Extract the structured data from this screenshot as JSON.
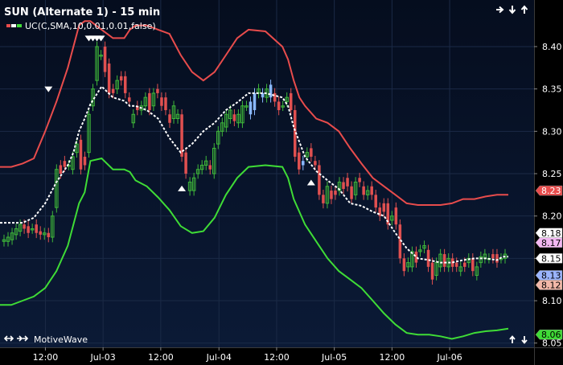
{
  "title": "SUN (Alternate 1) - 15 min",
  "brand": "MotiveWave",
  "colors": {
    "bg_top": "#050d1e",
    "bg_bottom": "#0b1a36",
    "grid": "#1b2a46",
    "upper_band": "#e84c4c",
    "lower_band": "#3fdc36",
    "sma": "#ffffff",
    "candle_up": "#3fb83a",
    "candle_down": "#e05050",
    "candle_blue": "#8ab8ff"
  },
  "chart_data": {
    "type": "candlestick",
    "title": "SUN (Alternate 1) - 15 min",
    "legend": [
      {
        "label": "UC(C,SMA,10,0.01,0.01,false)",
        "placement": "top-left"
      }
    ],
    "y_axis": {
      "ticks": [
        "8.40",
        "8.35",
        "8.30",
        "8.25",
        "8.20",
        "8.15",
        "8.10",
        "8.05"
      ],
      "range": [
        8.045,
        8.455
      ],
      "grid": true
    },
    "x_axis": {
      "ticks": [
        "12:00",
        "Jul-03",
        "12:00",
        "Jul-04",
        "12:00",
        "Jul-05",
        "12:00",
        "Jul-06"
      ],
      "grid": true
    },
    "price_tags": [
      {
        "label": "8.23",
        "value": 8.23,
        "bg": "#e84c4c",
        "fg": "#ffffff"
      },
      {
        "label": "8.18",
        "value": 8.18,
        "bg": "#ffffff",
        "fg": "#000000"
      },
      {
        "label": "8.17",
        "value": 8.17,
        "bg": "#f3b7f2",
        "fg": "#000000"
      },
      {
        "label": "8.15",
        "value": 8.15,
        "bg": "#ffffff",
        "fg": "#000000"
      },
      {
        "label": "8.13",
        "value": 8.13,
        "bg": "#9ab4ff",
        "fg": "#000000"
      },
      {
        "label": "8.12",
        "value": 8.12,
        "bg": "#f2b8a8",
        "fg": "#000000"
      },
      {
        "label": "8.06",
        "value": 8.06,
        "bg": "#3fdc36",
        "fg": "#000000"
      }
    ],
    "series": [
      {
        "name": "upper",
        "x": [
          0,
          10,
          20,
          30,
          40,
          50,
          60,
          65,
          70,
          75,
          80,
          90,
          100,
          110,
          115,
          120,
          130,
          140,
          150,
          160,
          170,
          180,
          190,
          200,
          210,
          220,
          235,
          250,
          255,
          260,
          265,
          270,
          280,
          290,
          300,
          310,
          320,
          330,
          340,
          350,
          360,
          370,
          380,
          390,
          400,
          410,
          420,
          430,
          440,
          450
        ],
        "y": [
          8.258,
          8.258,
          8.262,
          8.268,
          8.3,
          8.335,
          8.375,
          8.4,
          8.425,
          8.43,
          8.43,
          8.42,
          8.41,
          8.41,
          8.42,
          8.425,
          8.425,
          8.42,
          8.415,
          8.39,
          8.37,
          8.36,
          8.37,
          8.39,
          8.41,
          8.42,
          8.418,
          8.4,
          8.385,
          8.36,
          8.34,
          8.33,
          8.315,
          8.31,
          8.3,
          8.28,
          8.262,
          8.245,
          8.235,
          8.225,
          8.215,
          8.213,
          8.213,
          8.213,
          8.215,
          8.22,
          8.22,
          8.223,
          8.225,
          8.225
        ]
      },
      {
        "name": "lower",
        "x": [
          0,
          10,
          20,
          30,
          40,
          50,
          60,
          65,
          70,
          75,
          80,
          90,
          100,
          110,
          115,
          120,
          130,
          140,
          150,
          160,
          170,
          180,
          190,
          200,
          210,
          220,
          235,
          250,
          255,
          260,
          265,
          270,
          280,
          290,
          300,
          310,
          320,
          330,
          340,
          350,
          360,
          370,
          380,
          390,
          400,
          410,
          420,
          430,
          440,
          450
        ],
        "y": [
          8.095,
          8.095,
          8.1,
          8.105,
          8.115,
          8.135,
          8.165,
          8.19,
          8.215,
          8.228,
          8.265,
          8.268,
          8.255,
          8.255,
          8.252,
          8.242,
          8.235,
          8.222,
          8.207,
          8.188,
          8.18,
          8.182,
          8.198,
          8.225,
          8.245,
          8.258,
          8.26,
          8.258,
          8.245,
          8.22,
          8.205,
          8.19,
          8.17,
          8.15,
          8.135,
          8.125,
          8.115,
          8.1,
          8.085,
          8.072,
          8.062,
          8.06,
          8.06,
          8.058,
          8.055,
          8.058,
          8.062,
          8.064,
          8.065,
          8.067
        ]
      },
      {
        "name": "sma",
        "x": [
          0,
          20,
          30,
          40,
          50,
          60,
          65,
          70,
          75,
          80,
          90,
          100,
          110,
          115,
          120,
          130,
          140,
          150,
          160,
          170,
          180,
          190,
          200,
          210,
          220,
          235,
          250,
          255,
          260,
          270,
          280,
          290,
          300,
          310,
          320,
          330,
          340,
          350,
          360,
          370,
          380,
          390,
          400,
          410,
          420,
          430,
          440,
          445,
          450
        ],
        "y": [
          8.192,
          8.192,
          8.198,
          8.215,
          8.24,
          8.26,
          8.275,
          8.3,
          8.315,
          8.332,
          8.353,
          8.34,
          8.336,
          8.33,
          8.33,
          8.325,
          8.315,
          8.292,
          8.275,
          8.285,
          8.3,
          8.31,
          8.325,
          8.334,
          8.345,
          8.345,
          8.34,
          8.33,
          8.305,
          8.27,
          8.253,
          8.242,
          8.232,
          8.215,
          8.212,
          8.205,
          8.2,
          8.18,
          8.162,
          8.15,
          8.148,
          8.145,
          8.145,
          8.148,
          8.15,
          8.15,
          8.148,
          8.152,
          8.152
        ]
      },
      {
        "name": "candles",
        "o": [
          8.17,
          8.17,
          8.172,
          8.178,
          8.182,
          8.19,
          8.188,
          8.185,
          8.19,
          8.182,
          8.178,
          8.18,
          8.175,
          8.21,
          8.26,
          8.265,
          8.26,
          8.255,
          8.275,
          8.29,
          8.27,
          8.275,
          8.33,
          8.36,
          8.39,
          8.4,
          8.38,
          8.35,
          8.35,
          8.365,
          8.365,
          8.34,
          8.31,
          8.33,
          8.325,
          8.33,
          8.345,
          8.33,
          8.35,
          8.34,
          8.34,
          8.32,
          8.315,
          8.315,
          8.32,
          8.275,
          8.23,
          8.23,
          8.25,
          8.255,
          8.26,
          8.26,
          8.25,
          8.285,
          8.3,
          8.305,
          8.315,
          8.32,
          8.31,
          8.31,
          8.33,
          8.335,
          8.325,
          8.345,
          8.345,
          8.34,
          8.355,
          8.345,
          8.335,
          8.33,
          8.335,
          8.345,
          8.325,
          8.275,
          8.26,
          8.27,
          8.28,
          8.265,
          8.26,
          8.225,
          8.215,
          8.23,
          8.23,
          8.23,
          8.24,
          8.245,
          8.235,
          8.225,
          8.245,
          8.235,
          8.225,
          8.235,
          8.225,
          8.21,
          8.215,
          8.215,
          8.195,
          8.21,
          8.19,
          8.15,
          8.14,
          8.14,
          8.158,
          8.158,
          8.162,
          8.16,
          8.145,
          8.13,
          8.14,
          8.155,
          8.14,
          8.15,
          8.145,
          8.135,
          8.145,
          8.145,
          8.15,
          8.13,
          8.145,
          8.15,
          8.15,
          8.155,
          8.155,
          8.15,
          8.15
        ],
        "c": [
          8.172,
          8.175,
          8.18,
          8.185,
          8.19,
          8.185,
          8.18,
          8.185,
          8.18,
          8.178,
          8.18,
          8.175,
          8.2,
          8.255,
          8.25,
          8.258,
          8.26,
          8.27,
          8.285,
          8.255,
          8.26,
          8.32,
          8.35,
          8.4,
          8.39,
          8.37,
          8.345,
          8.345,
          8.36,
          8.36,
          8.345,
          8.335,
          8.32,
          8.325,
          8.33,
          8.34,
          8.325,
          8.345,
          8.345,
          8.33,
          8.325,
          8.31,
          8.33,
          8.32,
          8.27,
          8.25,
          8.24,
          8.245,
          8.255,
          8.26,
          8.265,
          8.255,
          8.28,
          8.3,
          8.31,
          8.32,
          8.325,
          8.312,
          8.32,
          8.33,
          8.33,
          8.32,
          8.345,
          8.35,
          8.34,
          8.35,
          8.34,
          8.335,
          8.325,
          8.33,
          8.34,
          8.325,
          8.27,
          8.255,
          8.265,
          8.275,
          8.27,
          8.26,
          8.225,
          8.215,
          8.235,
          8.22,
          8.225,
          8.24,
          8.232,
          8.235,
          8.22,
          8.24,
          8.24,
          8.225,
          8.23,
          8.225,
          8.21,
          8.2,
          8.205,
          8.19,
          8.2,
          8.19,
          8.15,
          8.135,
          8.145,
          8.158,
          8.145,
          8.16,
          8.165,
          8.14,
          8.125,
          8.145,
          8.155,
          8.14,
          8.15,
          8.14,
          8.14,
          8.14,
          8.14,
          8.15,
          8.135,
          8.14,
          8.152,
          8.155,
          8.15,
          8.15,
          8.145,
          8.15,
          8.155
        ],
        "blue_indices": [
          61,
          62,
          64,
          66,
          74
        ]
      }
    ],
    "markers": [
      {
        "type": "down",
        "index": 11,
        "price": 8.35
      },
      {
        "type": "down",
        "index": 21,
        "price": 8.41
      },
      {
        "type": "down",
        "index": 22,
        "price": 8.41
      },
      {
        "type": "down",
        "index": 23,
        "price": 8.41
      },
      {
        "type": "down",
        "index": 24,
        "price": 8.41
      },
      {
        "type": "up",
        "index": 44,
        "price": 8.233
      },
      {
        "type": "up",
        "index": 76,
        "price": 8.24
      }
    ]
  }
}
